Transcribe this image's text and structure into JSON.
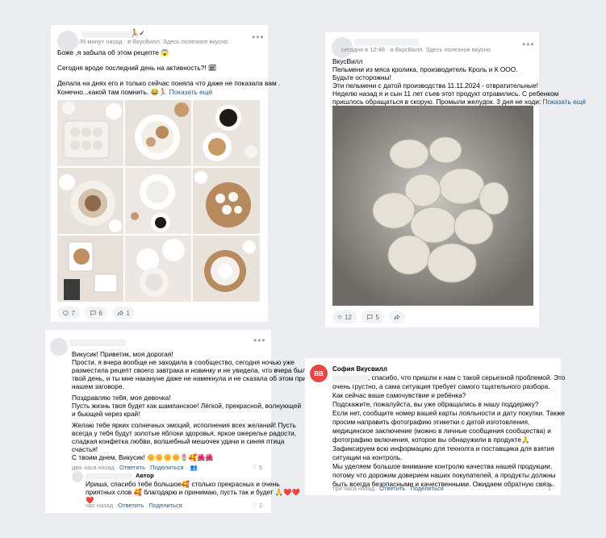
{
  "post1": {
    "time": "39 минут назад",
    "source": "в ВкусВилл. Здесь полезное вкусно",
    "lines": [
      "Боже ,я забыла об этом рецепте 😱",
      "",
      "Сегодня вроде последний день на активность?! 🗓",
      "",
      "Делала на днях его и только сейчас поняла что даже не показала вам .",
      "Конечно...какой там помнить. 😂🏃"
    ],
    "show_more": "Показать ещё",
    "likes": "7",
    "comments": "6",
    "shares": "1"
  },
  "post2": {
    "time": "сегодня в 12:48",
    "source": "в ВкусВилл. Здесь полезное вкусно",
    "lines": [
      "ВкусВилл",
      "Пельмени из мяса кролика, производитель Кроль и К ООО.",
      "Будьте осторожны!",
      "Эти пельмени с датой производства 11.11.2024 - отвратительные!",
      "Неделю назад я и сын 11 лет съев этот продукт отравились. С ребенком",
      "пришлось обращаться в скорую. Промыли желудок. 3 дня не ходи:"
    ],
    "show_more": "Показать ещё",
    "likes": "12",
    "comments": "5"
  },
  "comment1": {
    "lines": [
      "Викусик! Приветик, моя дорогая!",
      "Прости, я вчера вообще не заходила в сообщество, сегодня ночью уже",
      "разместила рецепт своего завтрака и новинку и не увидела, что вчера был",
      "твой день, и ты мне накануне даже не намекнула и не сказала об этом при",
      "нашем заговоре.",
      "",
      "Поздравляю тебя, моя девочка!",
      "Пусть жизнь твоя будет как шампанское! Лёгкой, прекрасной, волнующей",
      "и бьющей через край!",
      "",
      "Желаю тебе ярких солнечных эмоций, исполнения всех желаний! Пусть",
      "всегда у тебя будут золотые яблоки здоровья, яркое ожерелье радости,",
      "сладкая конфетка любви, волшебный мешочек удачи и синяя птица",
      "счастья!",
      "С твоим днем, Викусик! 🌼🌼🌼🌼🌷🥰🌺🌺"
    ],
    "time": "два часа назад",
    "reply": "Ответить",
    "share": "Поделиться",
    "likes": "5",
    "reply_author": "Автор",
    "reply_lines": [
      "Ириша, спасибо тебе большое🥰 столько прекрасных и очень",
      "приятных слов 🥰 благодарю и принимаю, пусть так и будет 🙏❤️❤️",
      "❤️"
    ],
    "reply_time": "час назад",
    "reply_reply": "Ответить",
    "reply_share": "Поделиться",
    "reply_likes": "1"
  },
  "comment2": {
    "author": "София Вкусвилл",
    "avatar_text": "ВВ",
    "lines": [
      ", спасибо, что пришли к нам с такой серьезной проблемой. Это",
      "очень грустно, а сама ситуация требует самого тщательного разбора.",
      "Как сейчас ваше самочувствие и ребёнка?",
      "Подскажите, пожалуйста, вы уже обращались в нашу поддержку?",
      "Если нет, сообщите номер вашей карты лояльности и дату покупки. Также",
      "просим направить фотографию этикетки с датой изготовления,",
      "медицинское заключение (можно в личные сообщения сообщества) и",
      "фотографию включения, которое вы обнаружили в продукте🙏",
      "Зафиксируем всю информацию для технолга и поставщика для взятия",
      "ситуации на контроль.",
      "Мы уделяем большое внимание контролю качества нашей продукции,",
      "потому что дорожим доверием наших покупателей, а продукты должны",
      "быть всегда безопасными и качественными. Ожидаем обратную связь."
    ],
    "time": "три часа назад",
    "reply": "Ответить",
    "share": "Поделиться",
    "likes": "1"
  },
  "colors": {
    "link": "#2a5885",
    "meta": "#818c99",
    "accent": "#e64646"
  }
}
